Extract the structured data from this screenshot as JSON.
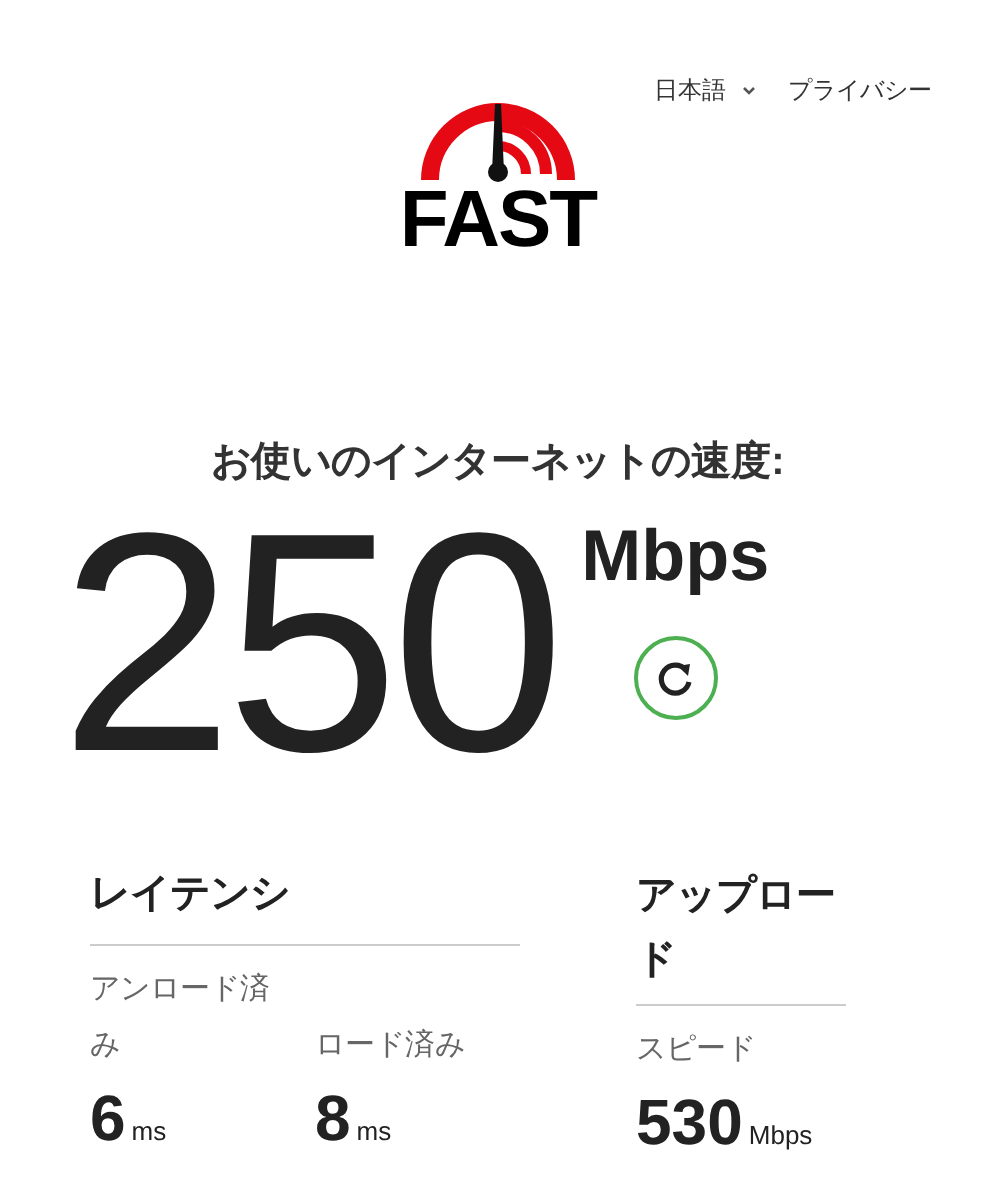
{
  "logo": {
    "text": "FAST"
  },
  "nav": {
    "language": "日本語",
    "privacy": "プライバシー"
  },
  "speed": {
    "title": "お使いのインターネットの速度:",
    "value": "250",
    "unit": "Mbps"
  },
  "latency": {
    "title": "レイテンシ",
    "items": [
      {
        "label": "アンロード済み",
        "value": "6",
        "unit": "ms"
      },
      {
        "label": "ロード済み",
        "value": "8",
        "unit": "ms"
      }
    ]
  },
  "upload": {
    "title": "アップロード",
    "label": "スピード",
    "value": "530",
    "unit": "Mbps"
  }
}
